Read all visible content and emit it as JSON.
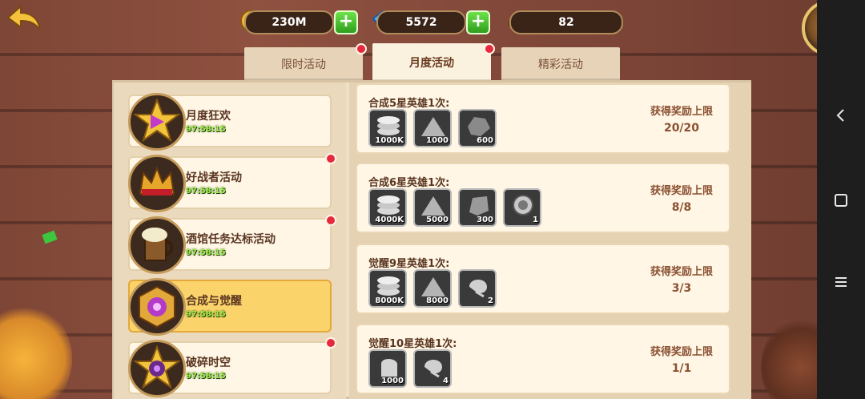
{
  "resources": [
    {
      "name": "gold",
      "value": "230M",
      "has_plus": true
    },
    {
      "name": "diamond",
      "value": "5572",
      "has_plus": true
    },
    {
      "name": "helmet",
      "value": "82",
      "has_plus": false
    }
  ],
  "tabs": [
    {
      "label": "限时活动",
      "active": false,
      "dot": true
    },
    {
      "label": "月度活动",
      "active": true,
      "dot": true
    },
    {
      "label": "精彩活动",
      "active": false,
      "dot": false
    }
  ],
  "events": [
    {
      "name": "月度狂欢",
      "timer": "97:58:15",
      "dot": false,
      "selected": false,
      "icon": "purple-gem-star-icon"
    },
    {
      "name": "好战者活动",
      "timer": "97:58:15",
      "dot": true,
      "selected": false,
      "icon": "crown-icon"
    },
    {
      "name": "酒馆任务达标活动",
      "timer": "97:58:15",
      "dot": true,
      "selected": false,
      "icon": "beer-mug-icon"
    },
    {
      "name": "合成与觉醒",
      "timer": "97:58:15",
      "dot": false,
      "selected": true,
      "icon": "hexagon-emblem-icon"
    },
    {
      "name": "破碎时空",
      "timer": "97:58:15",
      "dot": true,
      "selected": false,
      "icon": "vortex-star-icon"
    }
  ],
  "rewards": [
    {
      "title": "合成5星英雄1次:",
      "limit_label": "获得奖励上限",
      "limit_value": "20/20",
      "items": [
        {
          "icon": "coin-stack-icon",
          "count": "1000K"
        },
        {
          "icon": "dust-pile-icon",
          "count": "1000"
        },
        {
          "icon": "ore-chunk-icon",
          "count": "600"
        }
      ]
    },
    {
      "title": "合成6星英雄1次:",
      "limit_label": "获得奖励上限",
      "limit_value": "8/8",
      "items": [
        {
          "icon": "coin-stack-icon",
          "count": "4000K"
        },
        {
          "icon": "dust-pile-icon",
          "count": "5000"
        },
        {
          "icon": "stone-icon",
          "count": "300"
        },
        {
          "icon": "orb-icon",
          "count": "1"
        }
      ]
    },
    {
      "title": "觉醒9星英雄1次:",
      "limit_label": "获得奖励上限",
      "limit_value": "3/3",
      "items": [
        {
          "icon": "coin-stack-icon",
          "count": "8000K"
        },
        {
          "icon": "dust-pile-icon",
          "count": "8000"
        },
        {
          "icon": "seed-icon",
          "count": "2"
        }
      ]
    },
    {
      "title": "觉醒10星英雄1次:",
      "limit_label": "获得奖励上限",
      "limit_value": "1/1",
      "items": [
        {
          "icon": "crystal-shard-icon",
          "count": "1000"
        },
        {
          "icon": "seed-icon",
          "count": "4"
        }
      ]
    }
  ]
}
